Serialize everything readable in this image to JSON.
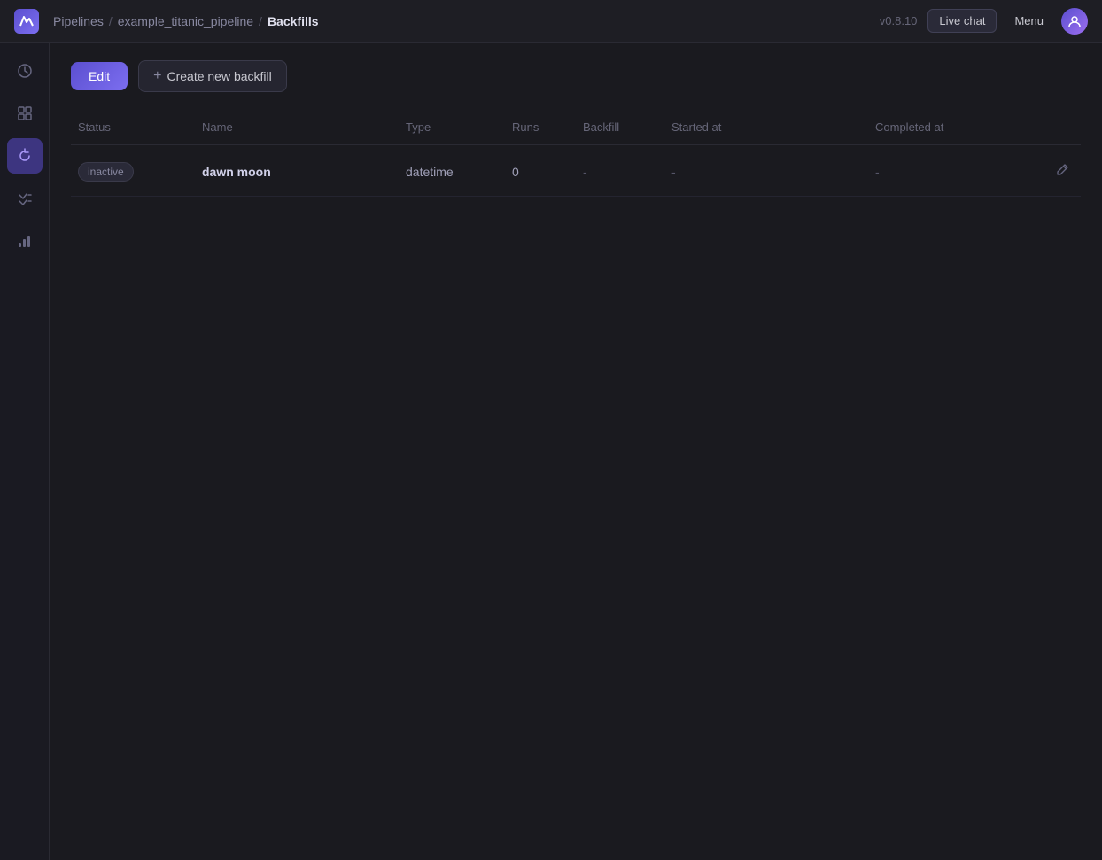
{
  "topNav": {
    "logo": "M",
    "breadcrumb": {
      "pipelines": "Pipelines",
      "separator1": "/",
      "pipeline_name": "example_titanic_pipeline",
      "separator2": "/",
      "current": "Backfills"
    },
    "version": "v0.8.10",
    "liveChat": "Live chat",
    "menu": "Menu"
  },
  "sidebar": {
    "items": [
      {
        "id": "history",
        "icon": "🕐",
        "label": "history-icon"
      },
      {
        "id": "dashboard",
        "icon": "⊞",
        "label": "dashboard-icon"
      },
      {
        "id": "backfills",
        "icon": "↺",
        "label": "backfills-icon",
        "active": true
      },
      {
        "id": "tasks",
        "icon": "☑",
        "label": "tasks-icon"
      },
      {
        "id": "metrics",
        "icon": "📊",
        "label": "metrics-icon"
      }
    ]
  },
  "toolbar": {
    "editLabel": "Edit",
    "createBackfillLabel": "Create new backfill"
  },
  "table": {
    "columns": [
      {
        "id": "status",
        "label": "Status"
      },
      {
        "id": "name",
        "label": "Name"
      },
      {
        "id": "type",
        "label": "Type"
      },
      {
        "id": "runs",
        "label": "Runs"
      },
      {
        "id": "backfill",
        "label": "Backfill"
      },
      {
        "id": "started_at",
        "label": "Started at"
      },
      {
        "id": "completed_at",
        "label": "Completed at"
      },
      {
        "id": "actions",
        "label": ""
      }
    ],
    "rows": [
      {
        "status": "inactive",
        "name": "dawn moon",
        "type": "datetime",
        "runs": "0",
        "backfill": "-",
        "started_at": "-",
        "completed_at": "-"
      }
    ]
  }
}
